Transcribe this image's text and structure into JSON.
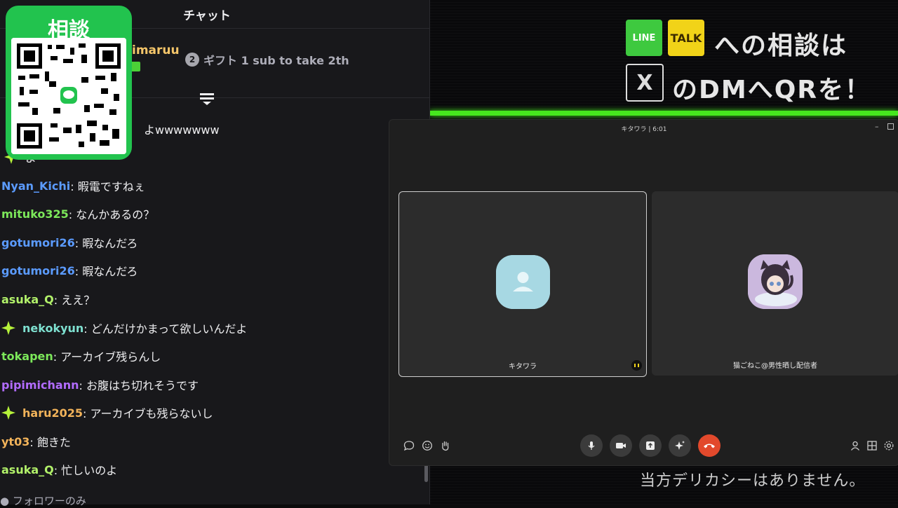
{
  "chat": {
    "header_title": "チャット",
    "pinned_user": "imaruu",
    "gift_count": "2",
    "gift_text": "ギフト 1 sub to take 2th",
    "messages": [
      {
        "user": "",
        "text": "よwwwwwww",
        "color": "#a970ff",
        "spark": false
      },
      {
        "user": "",
        "text": "よ",
        "color": "#efeff1",
        "spark": true
      },
      {
        "user": "Nyan_Kichi",
        "text": ": 暇電ですねぇ",
        "color": "#5b9bff",
        "spark": false
      },
      {
        "user": "mituko325",
        "text": ": なんかあるの？",
        "color": "#7ce85a",
        "spark": false
      },
      {
        "user": "gotumori26",
        "text": ": 暇なんだろ",
        "color": "#5b9bff",
        "spark": false
      },
      {
        "user": "gotumori26",
        "text": ": 暇なんだろ",
        "color": "#5b9bff",
        "spark": false
      },
      {
        "user": "asuka_Q",
        "text": ": ええ？",
        "color": "#b2f26a",
        "spark": false
      },
      {
        "user": "nekokyun",
        "text": ": どんだけかまって欲しいんだよ",
        "color": "#7ee0d0",
        "spark": true
      },
      {
        "user": "tokapen",
        "text": ": アーカイブ残らんし",
        "color": "#7ce85a",
        "spark": false
      },
      {
        "user": "pipimichann",
        "text": ": お腹はち切れそうです",
        "color": "#b26cff",
        "spark": false
      },
      {
        "user": "haru2025",
        "text": ": アーカイブも残らないし",
        "color": "#f2b35a",
        "spark": true
      },
      {
        "user": "yt03",
        "text": ": 飽きた",
        "color": "#f2b35a",
        "spark": false
      },
      {
        "user": "asuka_Q",
        "text": ": 忙しいのよ",
        "color": "#b2f26a",
        "spark": false
      }
    ],
    "follower_only": "フォロワーのみ"
  },
  "qr": {
    "label": "相談"
  },
  "overlay": {
    "line_badge": "LINE",
    "talk_badge": "TALK",
    "x_badge": "X",
    "line1": "への相談は",
    "line2": "のDMへQRを！",
    "disclaimer": "当方デリカシーはありません。"
  },
  "call": {
    "title": "キタワラ | 6:01",
    "participant1": "キタワラ",
    "participant2": "猫ごねこ@男性晒し配信者"
  },
  "colors": {
    "accent_green": "#46e81e",
    "end_call": "#e2492c",
    "qr_green": "#22c34e"
  }
}
